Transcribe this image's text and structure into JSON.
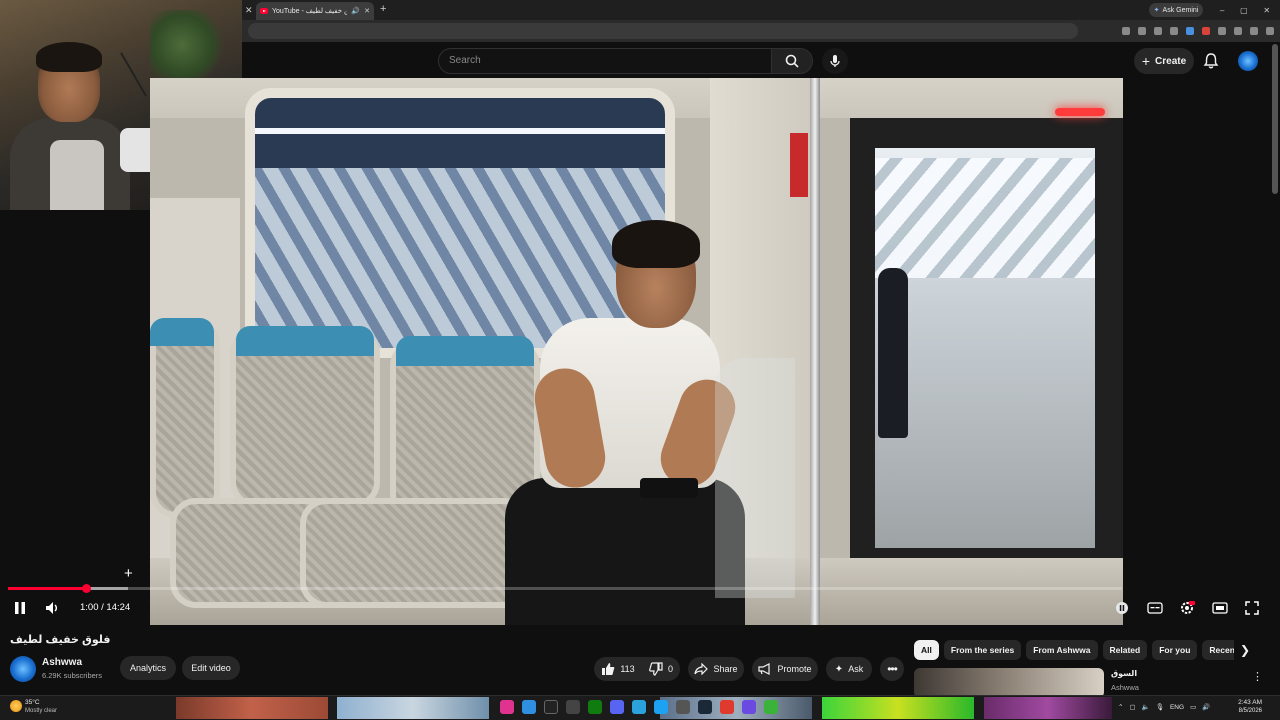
{
  "browser": {
    "tab_title": "YouTube - فلوق خفيف لطيف",
    "tab_close": "✕",
    "new_tab": "+",
    "ask_gemini": "Ask Gemini",
    "window_controls": [
      "–",
      "▢",
      "✕"
    ]
  },
  "header": {
    "search_placeholder": "Search",
    "create_label": "Create"
  },
  "player": {
    "time": "1:00 / 14:24",
    "progress": 0.07,
    "progress_color": "#ff0033"
  },
  "video_info": {
    "title": "فلوق خفيف لطيف",
    "channel_name": "Ashwwa",
    "subscribers": "6.29K subscribers",
    "analytics_label": "Analytics",
    "edit_label": "Edit video",
    "likes": "113",
    "dislikes": "0",
    "share_label": "Share",
    "promote_label": "Promote",
    "ask_label": "Ask"
  },
  "chips": [
    {
      "label": "All",
      "active": true
    },
    {
      "label": "From the series",
      "active": false
    },
    {
      "label": "From Ashwwa",
      "active": false
    },
    {
      "label": "Related",
      "active": false
    },
    {
      "label": "For you",
      "active": false
    },
    {
      "label": "Recen",
      "active": false
    }
  ],
  "recommendation": {
    "title": "السوق",
    "channel": "Ashwwa"
  },
  "taskbar": {
    "temperature": "35°C",
    "weather": "Mostly clear",
    "language": "ENG",
    "time": "2:43 AM",
    "date": "8/5/2026"
  }
}
